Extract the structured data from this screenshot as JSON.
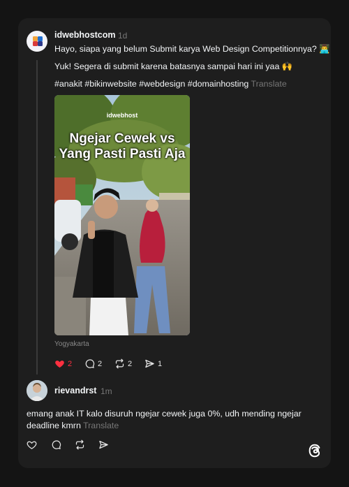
{
  "post": {
    "username": "idwebhostcom",
    "time": "1d",
    "line1": "Hayo, siapa yang belum Submit karya Web Design Competitionnya? 👨‍💻",
    "line2": "Yuk! Segera di submit karena batasnya sampai hari ini yaa 🙌",
    "hashtags": "#anakit #bikinwebsite #webdesign #domainhosting",
    "translate": "Translate",
    "media": {
      "brand": "idwebhost",
      "title_line1": "Ngejar Cewek vs",
      "title_line2": "Yang Pasti Pasti Aja"
    },
    "location": "Yogyakarta",
    "likes": "2",
    "comments": "2",
    "reposts": "2",
    "shares": "1",
    "liked": true,
    "like_color": "#ff3040"
  },
  "reply": {
    "username": "rievandrst",
    "time": "1m",
    "line1": "emang anak IT kalo disuruh ngejar cewek juga 0%, udh mending ngejar",
    "line2": "deadline kmrn",
    "translate": "Translate"
  },
  "icons": {
    "like": "heart-icon",
    "comment": "comment-bubble-icon",
    "repost": "repost-icon",
    "share": "send-icon",
    "app": "threads-logo-icon"
  }
}
